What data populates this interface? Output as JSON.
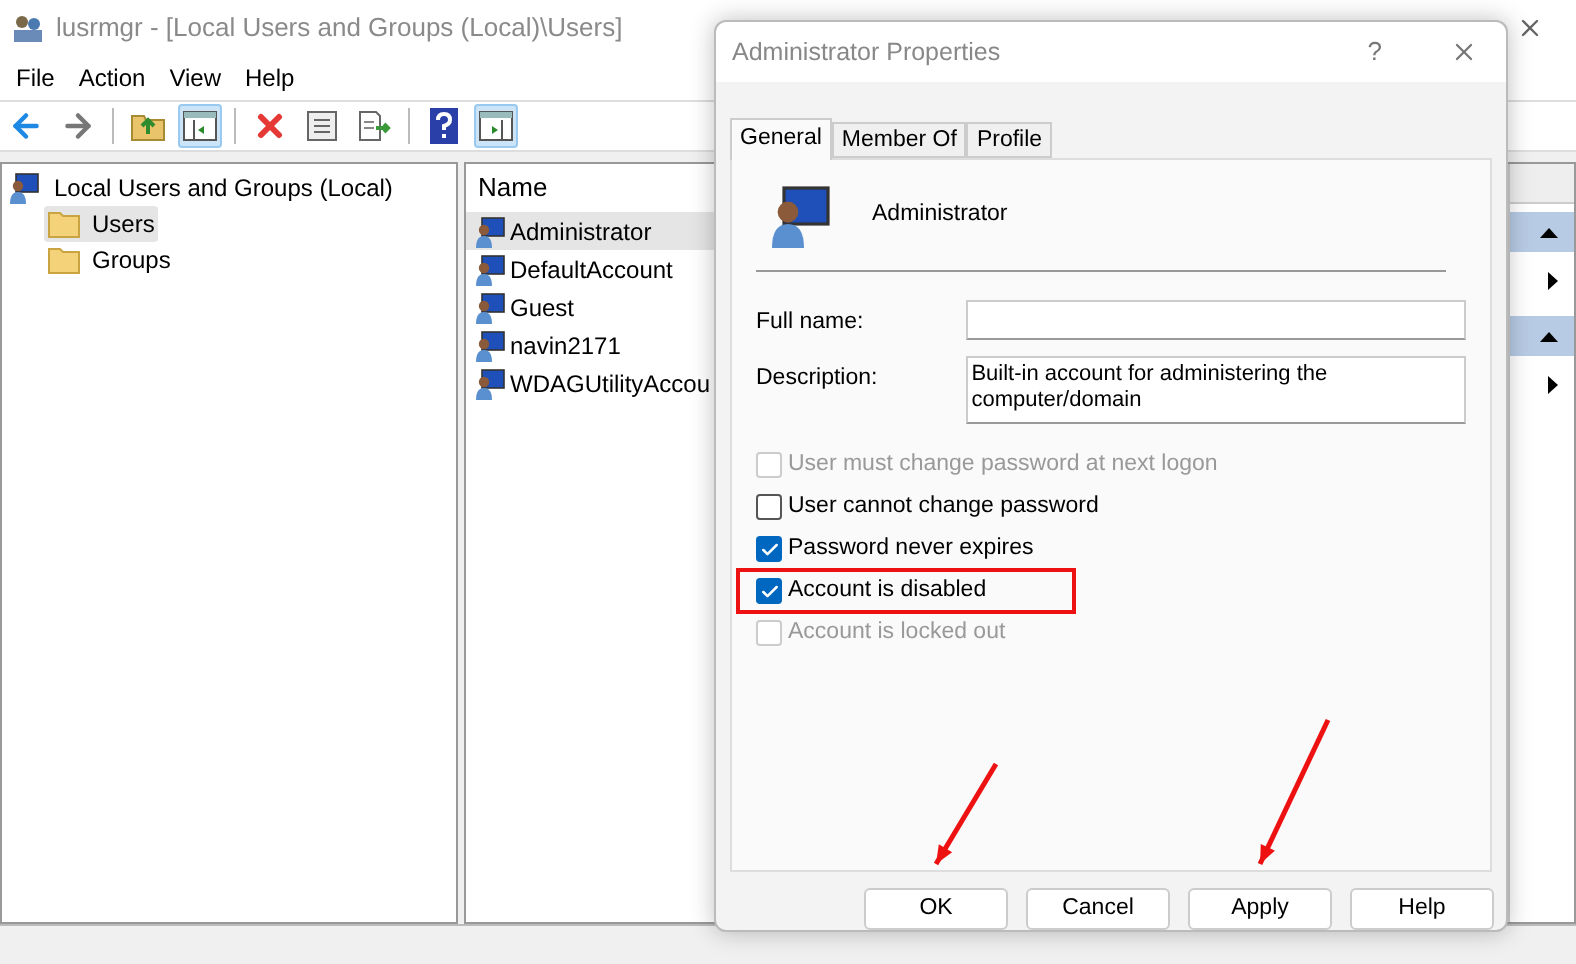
{
  "window": {
    "title": "lusrmgr - [Local Users and Groups (Local)\\Users]"
  },
  "menu": [
    "File",
    "Action",
    "View",
    "Help"
  ],
  "toolbar": [
    {
      "kind": "back",
      "pressed": false
    },
    {
      "kind": "forward",
      "pressed": false
    },
    {
      "kind": "up",
      "pressed": false
    },
    {
      "kind": "tree",
      "pressed": true
    },
    {
      "kind": "delete",
      "pressed": false
    },
    {
      "kind": "properties",
      "pressed": false
    },
    {
      "kind": "export",
      "pressed": false
    },
    {
      "kind": "help",
      "pressed": false
    },
    {
      "kind": "actions",
      "pressed": true
    }
  ],
  "tree": [
    {
      "label": "Local Users and Groups (Local)",
      "selected": false,
      "children": [
        {
          "label": "Users",
          "selected": true
        },
        {
          "label": "Groups",
          "selected": false
        }
      ]
    }
  ],
  "list": {
    "columns": [
      "Name"
    ],
    "rows": [
      {
        "name": "Administrator",
        "selected": true
      },
      {
        "name": "DefaultAccount",
        "selected": false
      },
      {
        "name": "Guest",
        "selected": false
      },
      {
        "name": "navin2171",
        "selected": false
      },
      {
        "name": "WDAGUtilityAccou",
        "selected": false
      }
    ]
  },
  "dialog": {
    "title": "Administrator Properties",
    "help": "?",
    "tabs": [
      {
        "label": "General",
        "selected": true
      },
      {
        "label": "Member Of",
        "selected": false
      },
      {
        "label": "Profile",
        "selected": false
      }
    ],
    "account_name": "Administrator",
    "fields": [
      {
        "label": "Full name:"
      },
      {
        "label": "Description:",
        "value": "Built-in account for administering the computer/domain"
      }
    ],
    "checkboxes": [
      {
        "label": "User must change password at next logon",
        "checked": false,
        "disabled": true,
        "highlighted": false
      },
      {
        "label": "User cannot change password",
        "checked": false,
        "disabled": false,
        "highlighted": false
      },
      {
        "label": "Password never expires",
        "checked": true,
        "disabled": false,
        "highlighted": false
      },
      {
        "label": "Account is disabled",
        "checked": true,
        "disabled": false,
        "highlighted": true
      },
      {
        "label": "Account is locked out",
        "checked": false,
        "disabled": true,
        "highlighted": false
      }
    ],
    "buttons": [
      {
        "label": "OK",
        "pointed": true
      },
      {
        "label": "Cancel",
        "pointed": false
      },
      {
        "label": "Apply",
        "pointed": true
      },
      {
        "label": "Help",
        "pointed": false
      }
    ]
  }
}
